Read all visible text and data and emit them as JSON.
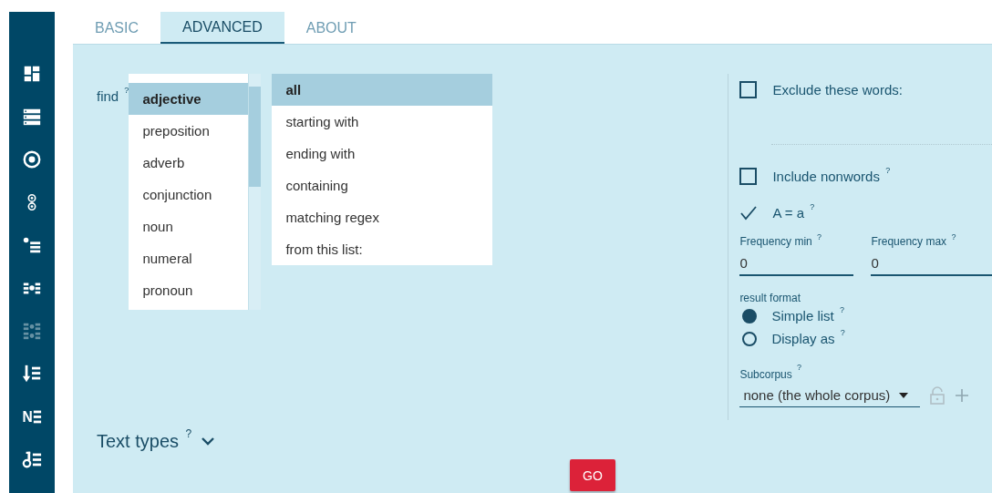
{
  "sidebar": {
    "items": [
      {
        "kind": "dashboard",
        "disabled": false
      },
      {
        "kind": "rows",
        "disabled": false
      },
      {
        "kind": "target",
        "disabled": false
      },
      {
        "kind": "double-circle",
        "disabled": false
      },
      {
        "kind": "bullet-list",
        "disabled": false
      },
      {
        "kind": "dot-list",
        "disabled": false
      },
      {
        "kind": "dot-grid",
        "disabled": true
      },
      {
        "kind": "sort-list",
        "disabled": false
      },
      {
        "kind": "letter-list",
        "glyph": "N",
        "disabled": false
      },
      {
        "kind": "key-list",
        "disabled": false
      }
    ]
  },
  "tabs": [
    {
      "label": "BASIC",
      "selected": false
    },
    {
      "label": "ADVANCED",
      "selected": true
    },
    {
      "label": "ABOUT",
      "selected": false
    }
  ],
  "find": {
    "label": "find $^{?}$",
    "categories": [
      {
        "label": "adjective",
        "selected": true
      },
      {
        "label": "preposition",
        "selected": false
      },
      {
        "label": "adverb",
        "selected": false
      },
      {
        "label": "conjunction",
        "selected": false
      },
      {
        "label": "noun",
        "selected": false
      },
      {
        "label": "numeral",
        "selected": false
      },
      {
        "label": "pronoun",
        "selected": false
      }
    ],
    "matching": [
      {
        "label": "all",
        "selected": true
      },
      {
        "label": "starting with",
        "selected": false
      },
      {
        "label": "ending with",
        "selected": false
      },
      {
        "label": "containing",
        "selected": false
      },
      {
        "label": "matching regex",
        "selected": false
      },
      {
        "label": "from this list:",
        "selected": false
      }
    ]
  },
  "options": {
    "exclude": {
      "label": "Exclude these words:",
      "checked": false
    },
    "include_nonwords": {
      "label": "Include nonwords $^{?}$",
      "checked": false
    },
    "case_insensitive": {
      "label": "A = a $^{?}$",
      "checked": true
    },
    "frequency_min": {
      "label": "Frequency min $^{?}$",
      "value": "0"
    },
    "frequency_max": {
      "label": "Frequency max $^{?}$",
      "value": "0"
    },
    "result_format": {
      "label": "result format",
      "options": [
        {
          "label": "Simple list $^{?}$",
          "selected": true
        },
        {
          "label": "Display as $^{?}$",
          "selected": false
        }
      ]
    },
    "subcorpus": {
      "label": "Subcorpus $^{?}$",
      "value": "none (the whole corpus)"
    }
  },
  "text_types": {
    "label": "Text types $^{?}$",
    "expanded": false
  },
  "go_button": "GO"
}
